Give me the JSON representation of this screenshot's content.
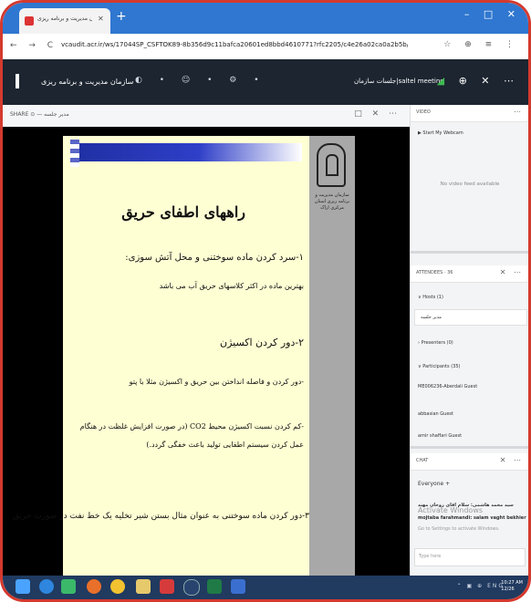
{
  "browser": {
    "tab_title": "سازمان مدیریت و برنامه ریزی",
    "tab_close": "✕",
    "new_tab": "+",
    "window_controls": "– □ ✕",
    "nav_controls": "← → C",
    "url": "vcaudit.acr.ir/ws/17044SP_CSFTOK89-8b356d9c11bafca20601ed8bbd4610771?rfc2205/c4e26a02ca0a2b5b/proto=true",
    "addr_icons": "☆ ⊕ ≡ ⋮"
  },
  "app_header": {
    "org_name": "سازمان مدیریت و برنامه ریزی",
    "controls": "◐ • ☺ • ⚙ •",
    "meeting_title": "جلسات سازمان|saltel meeting",
    "right_controls": "⊕ ✕ ⋯"
  },
  "share": {
    "label": "SHARE ⊙  — مدیر جلسه",
    "controls": "□ ✕ ⋯"
  },
  "slide": {
    "side_text": "سازمان مدیریت و برنامه ریزی استان مرکزی اراک",
    "title": "راههای اطفای حریق",
    "line1": "۱-سرد کردن ماده سوختنی و محل آتش سوزی:",
    "line2": "بهترین ماده در اکثر کلاسهای حریق آب می باشد",
    "line3": "۲-دور کردن اکسیژن",
    "line4": "-دور کردن و فاصله انداختن بین حریق و اکسیژن مثلا با پتو",
    "line5": "-کم کردن نسبت اکسیژن محیط CO2 (در صورت افزایش غلظت در هنگام",
    "line6": "عمل کردن سیستم اطفایی تولید باعث خفگی گردد.)",
    "line7": "۳-دور کردن ماده سوختنی به عنوان مثال بستن شیر تخلیه یک خط نفت در صورت حریق"
  },
  "panel": {
    "video_label": "VIDEO",
    "video_ctl": "⋯",
    "start_webcam": "▶ Start My Webcam",
    "no_feed": "No video feed available",
    "attendees_label": "ATTENDEES · 36",
    "attendees_ctl": "✕ ⋯",
    "hosts": "∨ Hosts (1)",
    "host_name": "مدیر جلسه",
    "presenters": "› Presenters (0)",
    "participants": "∨ Participants (35)",
    "p1": "ME006236-Aberdali  Guest",
    "p2": "abbasian  Guest",
    "p3": "amir shaffari  Guest",
    "chat_label": "CHAT",
    "chat_ctl": "✕ ⋯",
    "chat_tab": "Everyone  +",
    "chat_msg1": "سید محمد هاشمی: سلام اقای روحان مهند",
    "chat_msg2": "mojtaba farahmandi: salam vaght bekhier",
    "activate1": "Activate Windows",
    "activate2": "Go to Settings to activate Windows.",
    "chat_placeholder": "Type here"
  },
  "taskbar": {
    "icons": [
      "windows-icon",
      "edge-icon",
      "file-explorer-icon",
      "firefox-icon",
      "chrome-icon",
      "folder-icon",
      "acrobat-icon",
      "media-icon",
      "excel-icon",
      "word-icon"
    ],
    "tray": "⌃ ▣ ⊕ ENG",
    "clock_time": "10:27 AM",
    "clock_date": "12/26"
  }
}
